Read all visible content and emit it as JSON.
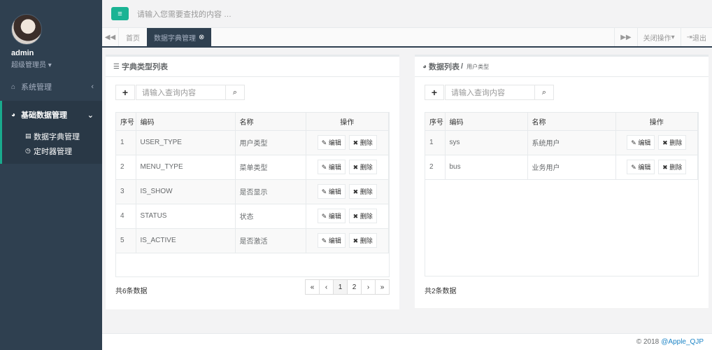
{
  "user": {
    "name": "admin",
    "role": "超级管理员"
  },
  "sidebar": {
    "items": [
      {
        "label": "系统管理"
      },
      {
        "label": "基础数据管理",
        "children": [
          {
            "label": "数据字典管理"
          },
          {
            "label": "定时器管理"
          }
        ]
      }
    ]
  },
  "topbar": {
    "search_placeholder": "请输入您需要查找的内容 …"
  },
  "tabs": {
    "items": [
      {
        "label": "首页"
      },
      {
        "label": "数据字典管理"
      }
    ],
    "close_ops": "关闭操作",
    "logout": "退出"
  },
  "left": {
    "title": "字典类型列表",
    "search_placeholder": "请输入查询内容",
    "columns": [
      "序号",
      "编码",
      "名称",
      "操作"
    ],
    "rows": [
      {
        "no": "1",
        "code": "USER_TYPE",
        "name": "用户类型"
      },
      {
        "no": "2",
        "code": "MENU_TYPE",
        "name": "菜单类型"
      },
      {
        "no": "3",
        "code": "IS_SHOW",
        "name": "是否显示"
      },
      {
        "no": "4",
        "code": "STATUS",
        "name": "状态"
      },
      {
        "no": "5",
        "code": "IS_ACTIVE",
        "name": "是否激活"
      }
    ],
    "edit": "编辑",
    "delete": "删除",
    "total": "共6条数据",
    "pager": [
      "«",
      "‹",
      "1",
      "2",
      "›",
      "»"
    ]
  },
  "right": {
    "title": "数据列表",
    "subtitle": "用户类型",
    "search_placeholder": "请输入查询内容",
    "columns": [
      "序号",
      "编码",
      "名称",
      "操作"
    ],
    "rows": [
      {
        "no": "1",
        "code": "sys",
        "name": "系统用户"
      },
      {
        "no": "2",
        "code": "bus",
        "name": "业务用户"
      }
    ],
    "edit": "编辑",
    "delete": "删除",
    "total": "共2条数据"
  },
  "footer": {
    "copyright": "© 2018",
    "author": "@Apple_QJP"
  },
  "colors": {
    "sidebar": "#2f4050",
    "accent": "#1ab394",
    "link": "#1c84c6"
  }
}
